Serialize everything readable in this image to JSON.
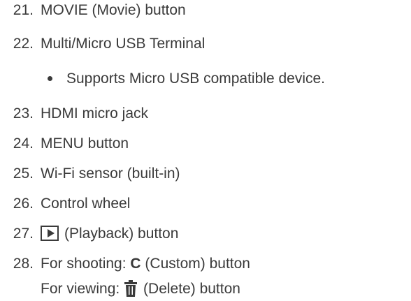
{
  "items": [
    {
      "num": "21.",
      "text": "MOVIE (Movie) button"
    },
    {
      "num": "22.",
      "text": "Multi/Micro USB Terminal"
    },
    {
      "bullet": "Supports Micro USB compatible device."
    },
    {
      "num": "23.",
      "text": "HDMI micro jack"
    },
    {
      "num": "24.",
      "text": "MENU button"
    },
    {
      "num": "25.",
      "text": "Wi-Fi sensor (built-in)"
    },
    {
      "num": "26.",
      "text": "Control wheel"
    },
    {
      "num": "27.",
      "text": "(Playback) button",
      "icon": "playback-icon"
    },
    {
      "num": "28.",
      "prefix": "For shooting: ",
      "bold": "C",
      "suffix": " (Custom) button"
    },
    {
      "prefix": "For viewing: ",
      "suffix": "(Delete) button",
      "icon": "trash-icon"
    }
  ]
}
